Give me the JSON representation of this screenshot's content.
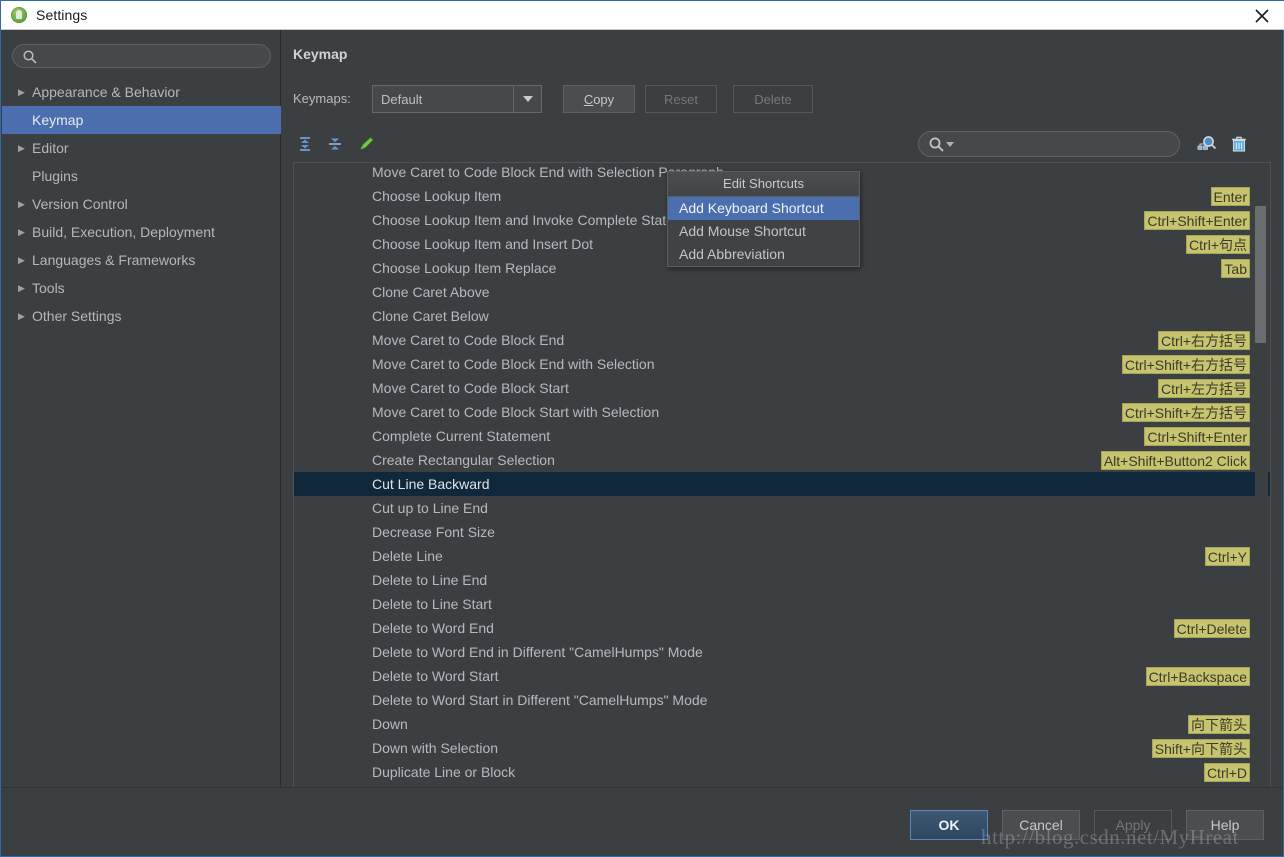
{
  "window": {
    "title": "Settings",
    "app_icon": "android-studio-icon",
    "close_icon": "close-icon"
  },
  "sidebar": {
    "search": {
      "value": "",
      "placeholder": "",
      "icon": "search-icon"
    },
    "items": [
      {
        "label": "Appearance & Behavior",
        "expandable": true,
        "selected": false
      },
      {
        "label": "Keymap",
        "expandable": false,
        "selected": true
      },
      {
        "label": "Editor",
        "expandable": true,
        "selected": false
      },
      {
        "label": "Plugins",
        "expandable": false,
        "selected": false
      },
      {
        "label": "Version Control",
        "expandable": true,
        "selected": false
      },
      {
        "label": "Build, Execution, Deployment",
        "expandable": true,
        "selected": false
      },
      {
        "label": "Languages & Frameworks",
        "expandable": true,
        "selected": false
      },
      {
        "label": "Tools",
        "expandable": true,
        "selected": false
      },
      {
        "label": "Other Settings",
        "expandable": true,
        "selected": false
      }
    ]
  },
  "main": {
    "page_title": "Keymap",
    "keymaps": {
      "label": "Keymaps:",
      "selected": "Default",
      "dropdown_icon": "chevron-down-icon",
      "buttons": [
        {
          "label": "Copy",
          "mnemonic": "C",
          "enabled": true
        },
        {
          "label": "Reset",
          "enabled": false
        },
        {
          "label": "Delete",
          "enabled": false
        }
      ]
    },
    "toolbar": {
      "expand_all_icon": "expand-all-icon",
      "collapse_all_icon": "collapse-all-icon",
      "edit_icon": "pencil-edit-icon",
      "search": {
        "value": "",
        "placeholder": "",
        "icon": "search-dropdown-icon"
      },
      "find_by_shortcut_icon": "find-by-shortcut-icon",
      "reset_filter_icon": "trash-icon"
    },
    "list": {
      "rows": [
        {
          "label": "Move Caret to Code Block End with Selection Paragraph",
          "shortcut": "",
          "clipped_top": true,
          "selected": false
        },
        {
          "label": "Choose Lookup Item",
          "shortcut": "Enter",
          "selected": false
        },
        {
          "label": "Choose Lookup Item and Invoke Complete Statement",
          "shortcut": "Ctrl+Shift+Enter",
          "selected": false
        },
        {
          "label": "Choose Lookup Item and Insert Dot",
          "shortcut": "Ctrl+句点",
          "selected": false
        },
        {
          "label": "Choose Lookup Item Replace",
          "shortcut": "Tab",
          "selected": false
        },
        {
          "label": "Clone Caret Above",
          "shortcut": "",
          "selected": false
        },
        {
          "label": "Clone Caret Below",
          "shortcut": "",
          "selected": false
        },
        {
          "label": "Move Caret to Code Block End",
          "shortcut": "Ctrl+右方括号",
          "selected": false
        },
        {
          "label": "Move Caret to Code Block End with Selection",
          "shortcut": "Ctrl+Shift+右方括号",
          "selected": false
        },
        {
          "label": "Move Caret to Code Block Start",
          "shortcut": "Ctrl+左方括号",
          "selected": false
        },
        {
          "label": "Move Caret to Code Block Start with Selection",
          "shortcut": "Ctrl+Shift+左方括号",
          "selected": false
        },
        {
          "label": "Complete Current Statement",
          "shortcut": "Ctrl+Shift+Enter",
          "selected": false
        },
        {
          "label": "Create Rectangular Selection",
          "shortcut": "Alt+Shift+Button2 Click",
          "selected": false
        },
        {
          "label": "Cut Line Backward",
          "shortcut": "",
          "selected": true
        },
        {
          "label": "Cut up to Line End",
          "shortcut": "",
          "selected": false
        },
        {
          "label": "Decrease Font Size",
          "shortcut": "",
          "selected": false
        },
        {
          "label": "Delete Line",
          "shortcut": "Ctrl+Y",
          "selected": false
        },
        {
          "label": "Delete to Line End",
          "shortcut": "",
          "selected": false
        },
        {
          "label": "Delete to Line Start",
          "shortcut": "",
          "selected": false
        },
        {
          "label": "Delete to Word End",
          "shortcut": "Ctrl+Delete",
          "selected": false
        },
        {
          "label": "Delete to Word End in Different \"CamelHumps\" Mode",
          "shortcut": "",
          "selected": false
        },
        {
          "label": "Delete to Word Start",
          "shortcut": "Ctrl+Backspace",
          "selected": false
        },
        {
          "label": "Delete to Word Start in Different \"CamelHumps\" Mode",
          "shortcut": "",
          "selected": false
        },
        {
          "label": "Down",
          "shortcut": "向下箭头",
          "selected": false
        },
        {
          "label": "Down with Selection",
          "shortcut": "Shift+向下箭头",
          "selected": false
        },
        {
          "label": "Duplicate Line or Block",
          "shortcut": "Ctrl+D",
          "selected": false
        }
      ]
    }
  },
  "context_menu": {
    "header": "Edit Shortcuts",
    "items": [
      {
        "label": "Add Keyboard Shortcut",
        "highlighted": true
      },
      {
        "label": "Add Mouse Shortcut",
        "highlighted": false
      },
      {
        "label": "Add Abbreviation",
        "highlighted": false
      }
    ]
  },
  "footer": {
    "buttons": [
      {
        "label": "OK",
        "primary": true,
        "enabled": true
      },
      {
        "label": "Cancel",
        "primary": false,
        "enabled": true
      },
      {
        "label": "Apply",
        "primary": false,
        "enabled": false
      },
      {
        "label": "Help",
        "primary": false,
        "enabled": true
      }
    ]
  },
  "watermark": {
    "text": "http://blog.csdn.net/MyHreat"
  },
  "colors": {
    "window_bg": "#3c3f41",
    "selection_blue": "#4b6eaf",
    "row_selected": "#10283c",
    "shortcut_badge": "#c8c36e",
    "accent_border": "#2d6ca8"
  }
}
